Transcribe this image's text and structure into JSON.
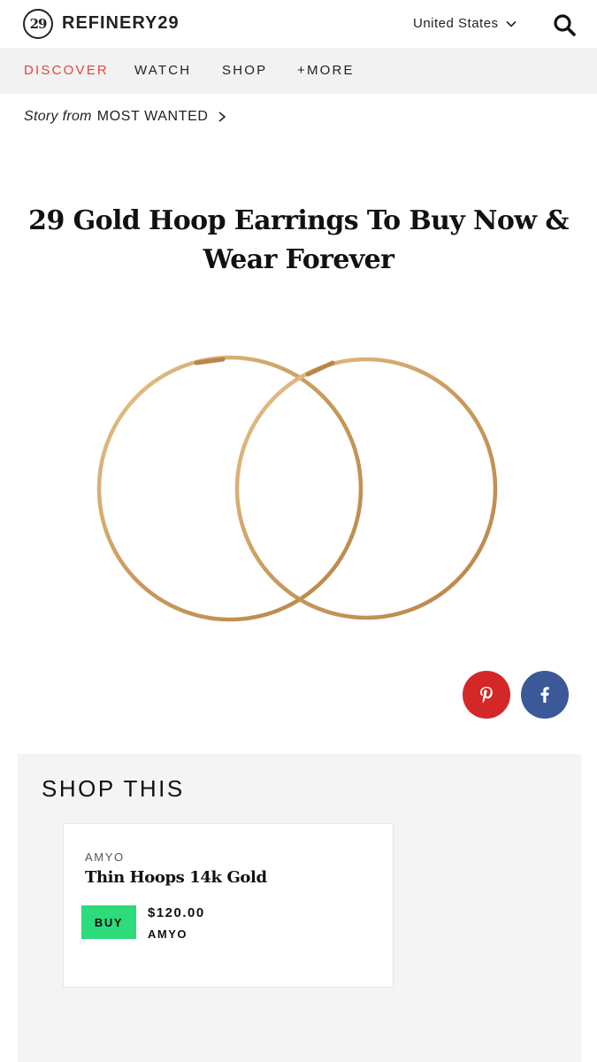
{
  "header": {
    "logo_mark": "29",
    "logo_text": "REFINERY29",
    "region": "United States"
  },
  "nav": {
    "items": [
      {
        "label": "DISCOVER",
        "active": true
      },
      {
        "label": "WATCH",
        "active": false
      },
      {
        "label": "SHOP",
        "active": false
      },
      {
        "label": "+MORE",
        "active": false
      }
    ]
  },
  "story": {
    "prefix": "Story from",
    "section": "MOST WANTED"
  },
  "article": {
    "title": "29 Gold Hoop Earrings To Buy Now & Wear Forever"
  },
  "share": {
    "pinterest_icon": "pinterest-icon",
    "facebook_icon": "facebook-icon"
  },
  "shop": {
    "heading": "SHOP THIS",
    "product": {
      "brand": "AMYO",
      "name": "Thin Hoops 14k Gold",
      "buy_label": "BUY",
      "price": "$120.00",
      "retailer": "AMYO"
    }
  },
  "colors": {
    "accent": "#e2453a",
    "nav_bg": "#f2f2f2",
    "buy_green": "#2ddb7a",
    "pinterest": "#d42727",
    "facebook": "#3b5998",
    "gold": "#c9a063"
  }
}
